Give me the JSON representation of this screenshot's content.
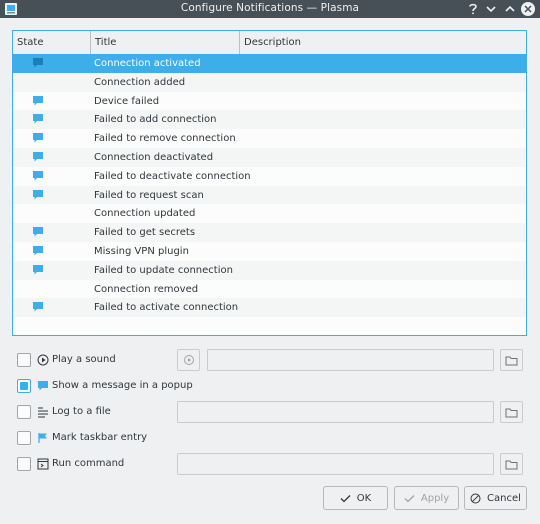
{
  "window": {
    "title": "Configure Notifications — Plasma"
  },
  "list": {
    "columns": {
      "state": "State",
      "title": "Title",
      "description": "Description"
    },
    "rows": [
      {
        "title": "Connection activated",
        "popup": true,
        "selected": true
      },
      {
        "title": "Connection added",
        "popup": false
      },
      {
        "title": "Device failed",
        "popup": true
      },
      {
        "title": "Failed to add connection",
        "popup": true
      },
      {
        "title": "Failed to remove connection",
        "popup": true
      },
      {
        "title": "Connection deactivated",
        "popup": true
      },
      {
        "title": "Failed to deactivate connection",
        "popup": true
      },
      {
        "title": "Failed to request scan",
        "popup": true
      },
      {
        "title": "Connection updated",
        "popup": false
      },
      {
        "title": "Failed to get secrets",
        "popup": true
      },
      {
        "title": "Missing VPN plugin",
        "popup": true
      },
      {
        "title": "Failed to update connection",
        "popup": true
      },
      {
        "title": "Connection removed",
        "popup": false
      },
      {
        "title": "Failed to activate connection",
        "popup": true
      },
      {
        "title": "",
        "popup": false
      }
    ]
  },
  "options": {
    "play_sound": {
      "label": "Play a sound",
      "checked": false
    },
    "show_popup": {
      "label": "Show a message in a popup",
      "checked": true
    },
    "log_file": {
      "label": "Log to a file",
      "checked": false
    },
    "mark_taskbar": {
      "label": "Mark taskbar entry",
      "checked": false
    },
    "run_command": {
      "label": "Run command",
      "checked": false
    }
  },
  "buttons": {
    "ok": "OK",
    "apply": "Apply",
    "cancel": "Cancel"
  },
  "colors": {
    "accent": "#3daee9",
    "titlebar": "#475057",
    "window_bg": "#eff0f1"
  }
}
